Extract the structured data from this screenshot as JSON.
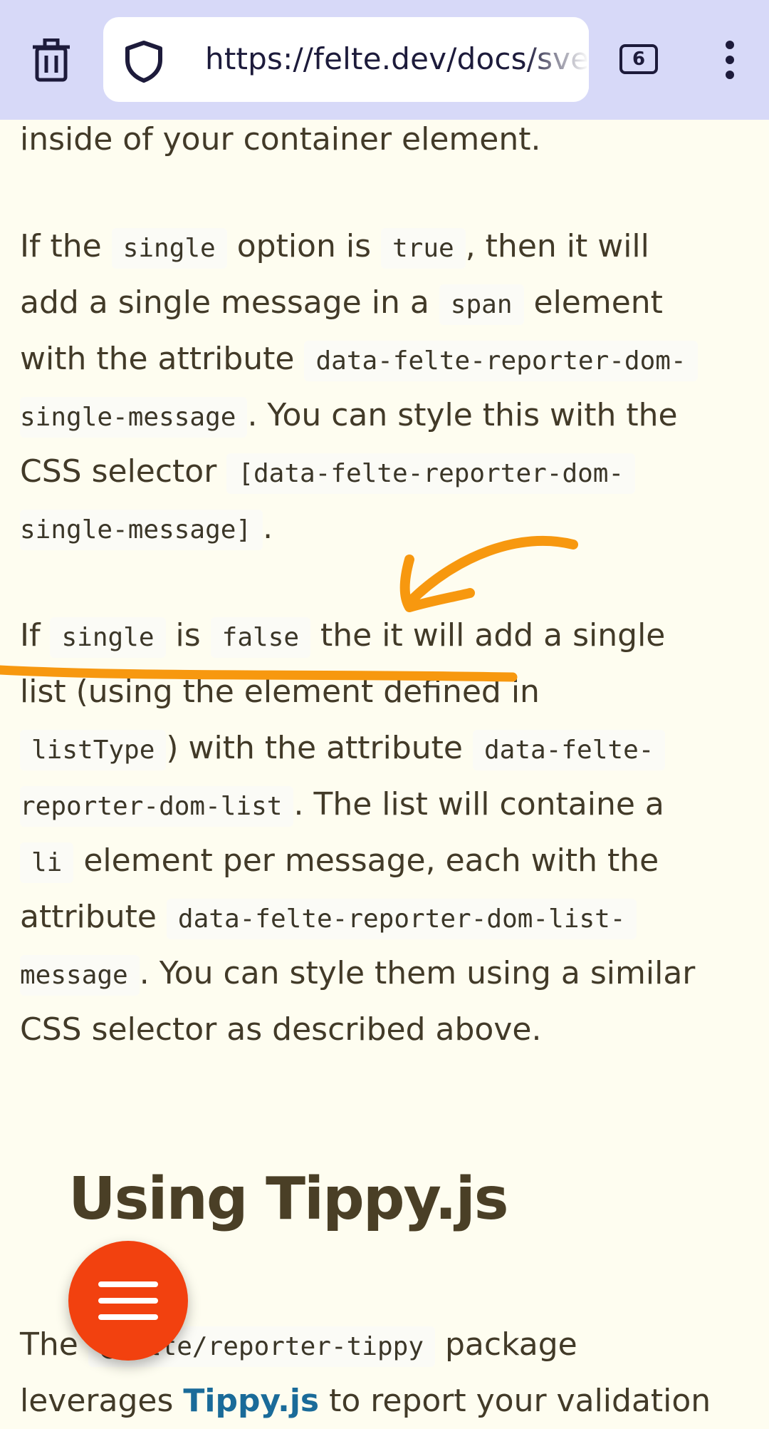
{
  "browser": {
    "url": "https://felte.dev/docs/svelte/reporters",
    "tab_count": "6",
    "icons": [
      "trash-icon",
      "shield-icon",
      "tabs-icon",
      "more-vert-icon"
    ]
  },
  "content": {
    "line0": "inside of your container element.",
    "para1": {
      "l1_a": "If the",
      "l1_code1": "single",
      "l1_b": "option is",
      "l1_code2": "true",
      "l1_c": ", then it will",
      "l2_a": "add a single message in a",
      "l2_code": "span",
      "l2_b": "element",
      "l3_a": "with the attribute",
      "l3_code": "data-felte-reporter-dom-",
      "l4_code": "single-message",
      "l4_a": ". You can style this with the",
      "l5_a": "CSS selector",
      "l5_code": "[data-felte-reporter-dom-",
      "l6_code": "single-message]",
      "l6_a": "."
    },
    "para2": {
      "l1_a": "If",
      "l1_code1": "single",
      "l1_b": "is",
      "l1_code2": "false",
      "l1_c": "the it will add a single",
      "l2_a": "list (using the element defined in",
      "l3_code": "listType",
      "l3_a": ") with the attribute",
      "l3_code2": "data-felte-",
      "l4_code": "reporter-dom-list",
      "l4_a": ". The list will containe a",
      "l5_code": "li",
      "l5_a": "element per message, each with the",
      "l6_a": "attribute",
      "l6_code": "data-felte-reporter-dom-list-",
      "l7_code": "message",
      "l7_a": ". You can style them using a similar",
      "l8_a": "CSS selector as described above."
    },
    "heading": "Using Tippy.js",
    "para3": {
      "l1_a": "The",
      "l1_code": "@felte/reporter-tippy",
      "l1_b": "package",
      "l2_a": "leverages",
      "l2_link": "Tippy.js",
      "l2_b": "to report your validation"
    }
  },
  "colors": {
    "toolbar": "#d7d9f8",
    "page_bg": "#fefdf0",
    "annotation": "#f7980f",
    "fab": "#f2410f",
    "link": "#1a6b99"
  }
}
